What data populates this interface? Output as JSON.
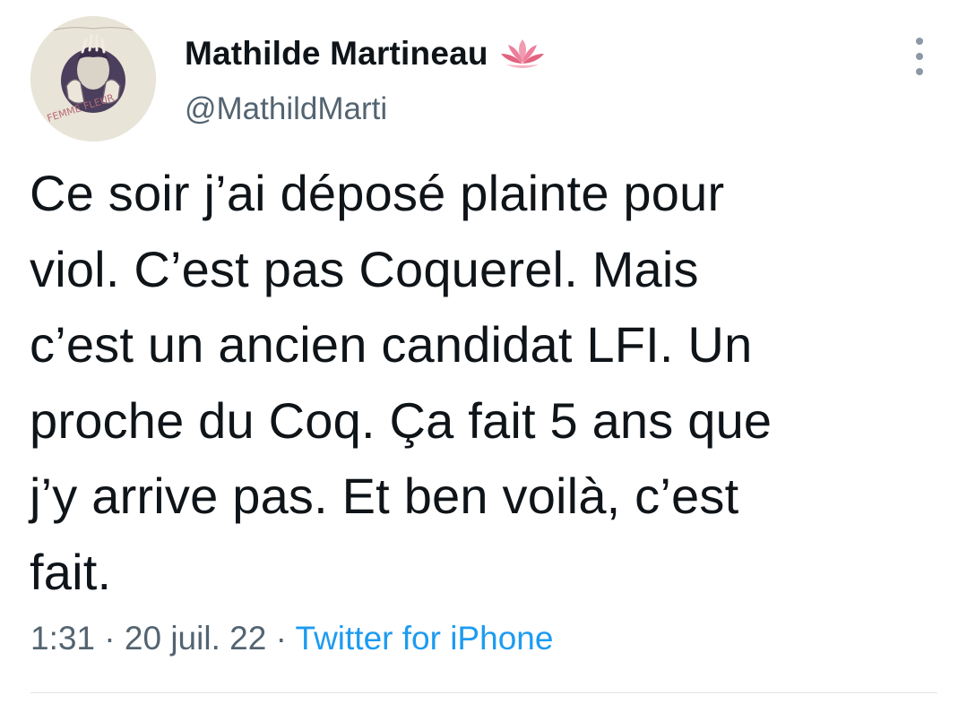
{
  "author": {
    "display_name": "Mathilde Martineau",
    "handle": "@MathildMarti",
    "name_emoji": "lotus-icon",
    "avatar_caption": "FEMME FLEUR"
  },
  "tweet": {
    "text": "Ce soir j’ai déposé plainte pour\nviol. C’est pas Coquerel. Mais\nc’est un ancien candidat LFI. Un\nproche du Coq. Ça fait 5 ans que\nj’y arrive pas. Et ben voilà, c’est\nfait.",
    "time": "1:31",
    "separator": " · ",
    "date": "20 juil. 22",
    "source": "Twitter for iPhone"
  },
  "colors": {
    "text": "#0f1419",
    "secondary": "#536471",
    "link": "#1d9bf0",
    "divider": "#dfe3e7"
  }
}
